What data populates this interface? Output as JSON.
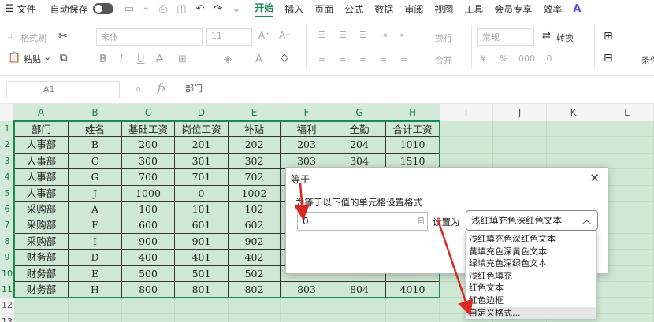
{
  "menubar": {
    "file": "文件",
    "autosave": "自动保存",
    "tabs": [
      "开始",
      "插入",
      "页面",
      "公式",
      "数据",
      "审阅",
      "视图",
      "工具",
      "会员专享",
      "效率"
    ]
  },
  "ribbon": {
    "format_painter": "格式刷",
    "paste": "粘贴",
    "font_name": "宋体",
    "font_size": "11",
    "wrap": "换行",
    "merge": "合并",
    "number_format": "常规",
    "convert": "转换",
    "cond": "条件"
  },
  "formula_bar": {
    "cell_ref": "A1",
    "fx": "fx",
    "value": "部门"
  },
  "columns": [
    "A",
    "B",
    "C",
    "D",
    "E",
    "F",
    "G",
    "H",
    "I",
    "J",
    "K",
    "L"
  ],
  "rows": [
    "1",
    "2",
    "3",
    "4",
    "5",
    "6",
    "7",
    "8",
    "9",
    "10",
    "11",
    "12",
    "13"
  ],
  "table": {
    "header": [
      "部门",
      "姓名",
      "基础工资",
      "岗位工资",
      "补贴",
      "福利",
      "全勤",
      "合计工资"
    ],
    "rows": [
      [
        "人事部",
        "B",
        "200",
        "201",
        "202",
        "203",
        "204",
        "1010"
      ],
      [
        "人事部",
        "C",
        "300",
        "301",
        "302",
        "303",
        "304",
        "1510"
      ],
      [
        "人事部",
        "G",
        "700",
        "701",
        "702",
        "",
        "",
        ""
      ],
      [
        "人事部",
        "J",
        "1000",
        "0",
        "1002",
        "",
        "",
        ""
      ],
      [
        "采购部",
        "A",
        "100",
        "101",
        "102",
        "",
        "",
        ""
      ],
      [
        "采购部",
        "F",
        "600",
        "601",
        "602",
        "",
        "",
        ""
      ],
      [
        "采购部",
        "I",
        "900",
        "901",
        "902",
        "",
        "",
        ""
      ],
      [
        "财务部",
        "D",
        "400",
        "401",
        "402",
        "",
        "",
        ""
      ],
      [
        "财务部",
        "E",
        "500",
        "501",
        "502",
        "",
        "",
        ""
      ],
      [
        "财务部",
        "H",
        "800",
        "801",
        "802",
        "803",
        "804",
        "4010"
      ]
    ]
  },
  "dialog": {
    "title": "等于",
    "prompt": "为等于以下值的单元格设置格式",
    "value": "0",
    "set_as_label": "设置为",
    "selected_format": "浅红填充色深红色文本"
  },
  "dropdown": {
    "options": [
      "浅红填充色深红色文本",
      "黄填充色深黄色文本",
      "绿填充色深绿色文本",
      "浅红色填充",
      "红色文本",
      "红色边框",
      "自定义格式..."
    ]
  },
  "colors": {
    "accent": "#1a8a55",
    "selection_fill": "#cfe8d3",
    "arrow_red": "#d9281f"
  }
}
